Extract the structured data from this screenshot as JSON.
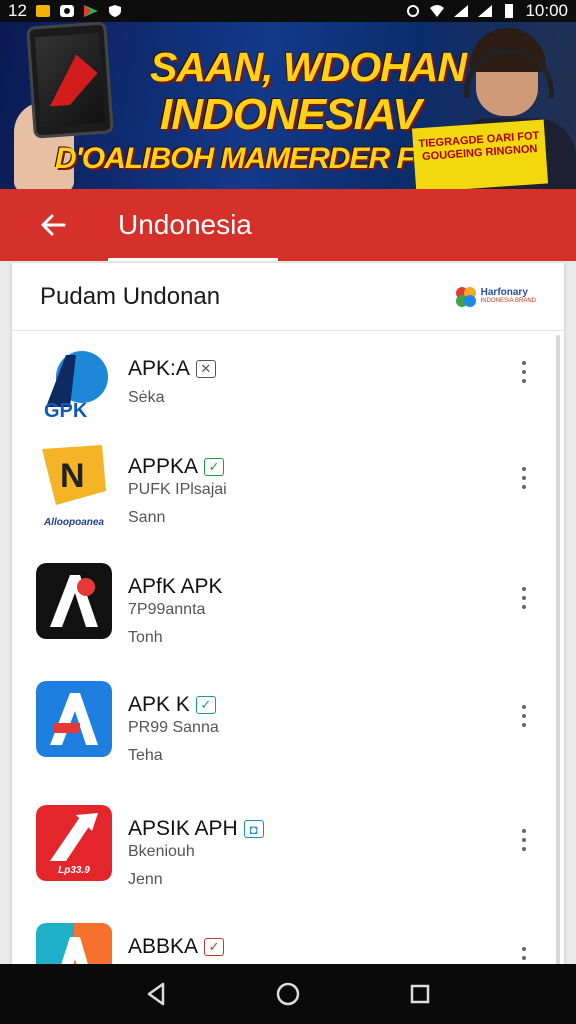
{
  "status_bar": {
    "time_left": "12",
    "time": "10:00",
    "icons_left": [
      "notification-icon",
      "photo-icon",
      "store-icon",
      "shield-icon"
    ],
    "icons_right": [
      "alarm-icon",
      "wifi-icon",
      "signal-icon",
      "signal-icon",
      "battery-icon"
    ]
  },
  "ad_banner": {
    "line1": "SAAN, WDOHAN",
    "line2": "INDONESIAV",
    "line3": "D'OALIBOH MAMERDER FUNI",
    "sticker": "TIEGRAGDE OARI FOT GOUGEING RINGNON"
  },
  "app_bar": {
    "back_icon": "arrow-back-icon",
    "title": "Undonesia"
  },
  "list": {
    "header_title": "Pudam Undonan",
    "brand_name": "Harfonary",
    "brand_sub": "INDONESIA BRAND",
    "apps": [
      {
        "name": "APK:A",
        "badge": "✕",
        "badge_color": "#555555",
        "line1": "Sėka",
        "line2": "",
        "icon_style": "blue-circle",
        "icon_text": "GPK",
        "icon_caption": ""
      },
      {
        "name": "APPKA",
        "badge": "✓",
        "badge_color": "#1e9e3a",
        "line1": "PUFK IPlsajai",
        "line2": "Sann",
        "icon_style": "gold",
        "icon_text": "N",
        "icon_caption": "Alloopoanea"
      },
      {
        "name": "APfK APK",
        "badge": "",
        "badge_color": "",
        "line1": "7P99annta",
        "line2": "Tonh",
        "icon_style": "black",
        "icon_text": "A",
        "icon_caption": ""
      },
      {
        "name": "APK K",
        "badge": "✓",
        "badge_color": "#1b9c8a",
        "line1": "PR99 Sanna",
        "line2": "Teha",
        "icon_style": "blue",
        "icon_text": "A",
        "icon_caption": ""
      },
      {
        "name": "APSIK APH",
        "badge": "◘",
        "badge_color": "#1f8ad3",
        "line1": "Bkeniouh",
        "line2": "Jenn",
        "icon_style": "red",
        "icon_text": "A",
        "icon_caption": "Lp33.9"
      },
      {
        "name": "ABBKA",
        "badge": "✓",
        "badge_color": "#c0392b",
        "line1": "",
        "line2": "",
        "icon_style": "multi",
        "icon_text": "A",
        "icon_caption": ""
      }
    ]
  },
  "nav_bar": {
    "back": "nav-back-icon",
    "home": "nav-home-icon",
    "recents": "nav-recents-icon"
  },
  "colors": {
    "app_bar": "#d5302a",
    "status_bar": "#0d0d0d",
    "nav_bar": "#0a0a0a"
  }
}
